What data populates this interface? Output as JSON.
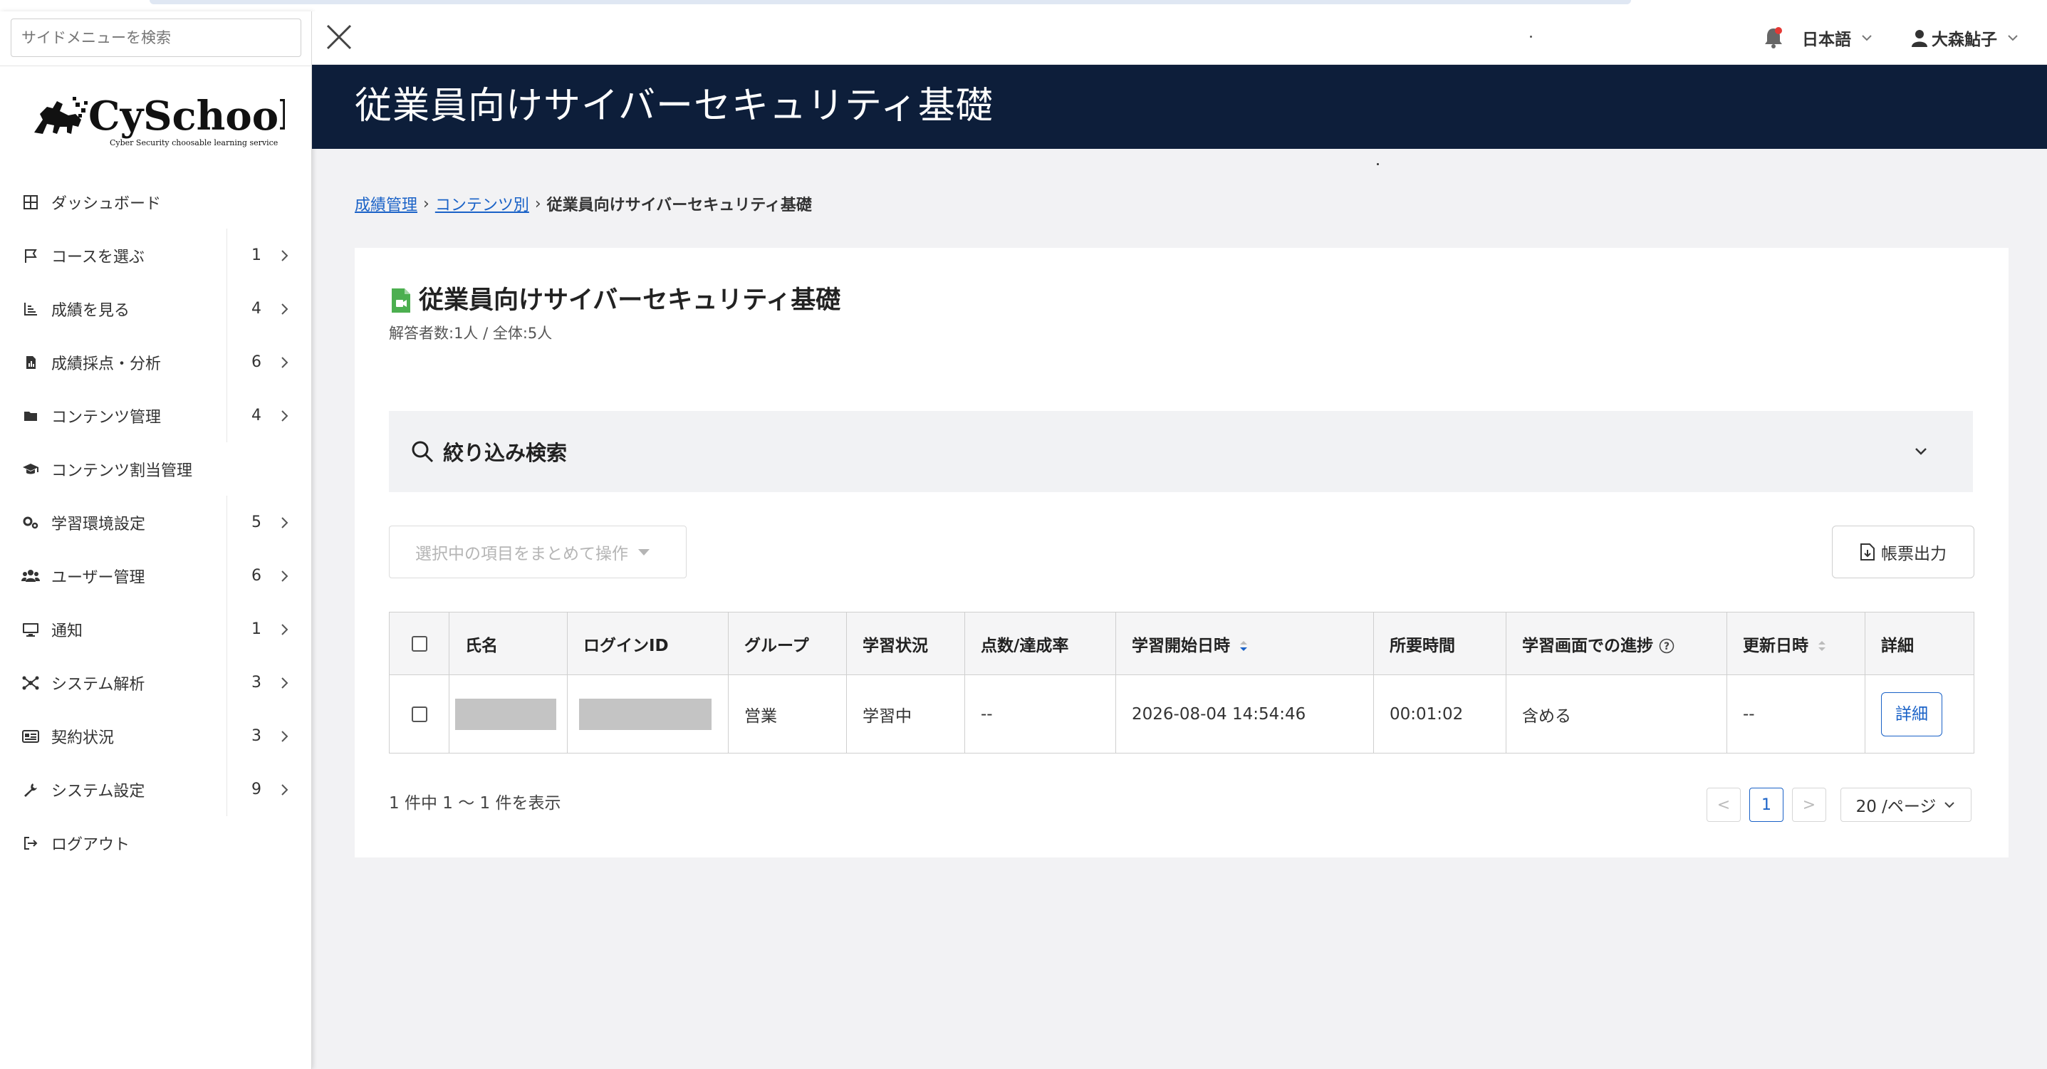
{
  "sidebar": {
    "search_placeholder": "サイドメニューを検索",
    "logo_text": "CySchools",
    "logo_tagline": "Cyber Security choosable learning service",
    "items": [
      {
        "label": "ダッシュボード",
        "count": "",
        "icon": "dashboard-icon"
      },
      {
        "label": "コースを選ぶ",
        "count": "1",
        "icon": "flag-icon"
      },
      {
        "label": "成績を見る",
        "count": "4",
        "icon": "chart-icon"
      },
      {
        "label": "成績採点・分析",
        "count": "6",
        "icon": "report-icon"
      },
      {
        "label": "コンテンツ管理",
        "count": "4",
        "icon": "folder-icon"
      },
      {
        "label": "コンテンツ割当管理",
        "count": "",
        "icon": "graduation-cap-icon"
      },
      {
        "label": "学習環境設定",
        "count": "5",
        "icon": "gears-icon"
      },
      {
        "label": "ユーザー管理",
        "count": "6",
        "icon": "users-icon"
      },
      {
        "label": "通知",
        "count": "1",
        "icon": "monitor-icon"
      },
      {
        "label": "システム解析",
        "count": "3",
        "icon": "network-icon"
      },
      {
        "label": "契約状況",
        "count": "3",
        "icon": "id-card-icon"
      },
      {
        "label": "システム設定",
        "count": "9",
        "icon": "wrench-icon"
      },
      {
        "label": "ログアウト",
        "count": "",
        "icon": "logout-icon"
      }
    ]
  },
  "header": {
    "language": "日本語",
    "user_name": "大森鮎子"
  },
  "page": {
    "title": "従業員向けサイバーセキュリティ基礎"
  },
  "breadcrumb": {
    "items": [
      "成績管理",
      "コンテンツ別"
    ],
    "current": "従業員向けサイバーセキュリティ基礎"
  },
  "card": {
    "title": "従業員向けサイバーセキュリティ基礎",
    "subtitle": "解答者数:1人 / 全体:5人",
    "filter_label": "絞り込み検索",
    "bulk_action": "選択中の項目をまとめて操作",
    "export_label": "帳票出力"
  },
  "table": {
    "headers": [
      "氏名",
      "ログインID",
      "グループ",
      "学習状況",
      "点数/達成率",
      "学習開始日時",
      "所要時間",
      "学習画面での進捗",
      "更新日時",
      "詳細"
    ],
    "rows": [
      {
        "name": "",
        "login_id": "",
        "group": "営業",
        "status": "学習中",
        "score": "--",
        "start": "2026-08-04 14:54:46",
        "duration": "00:01:02",
        "progress": "含める",
        "updated": "--",
        "detail": "詳細"
      }
    ]
  },
  "pagination": {
    "info": "1 件中 1 ～ 1 件を表示",
    "prev": "<",
    "current_page": "1",
    "next": ">",
    "page_size": "20 /ページ"
  },
  "colors": {
    "title_band": "#0d1e3a",
    "link": "#1a62c7",
    "notification_dot": "#e53935"
  }
}
